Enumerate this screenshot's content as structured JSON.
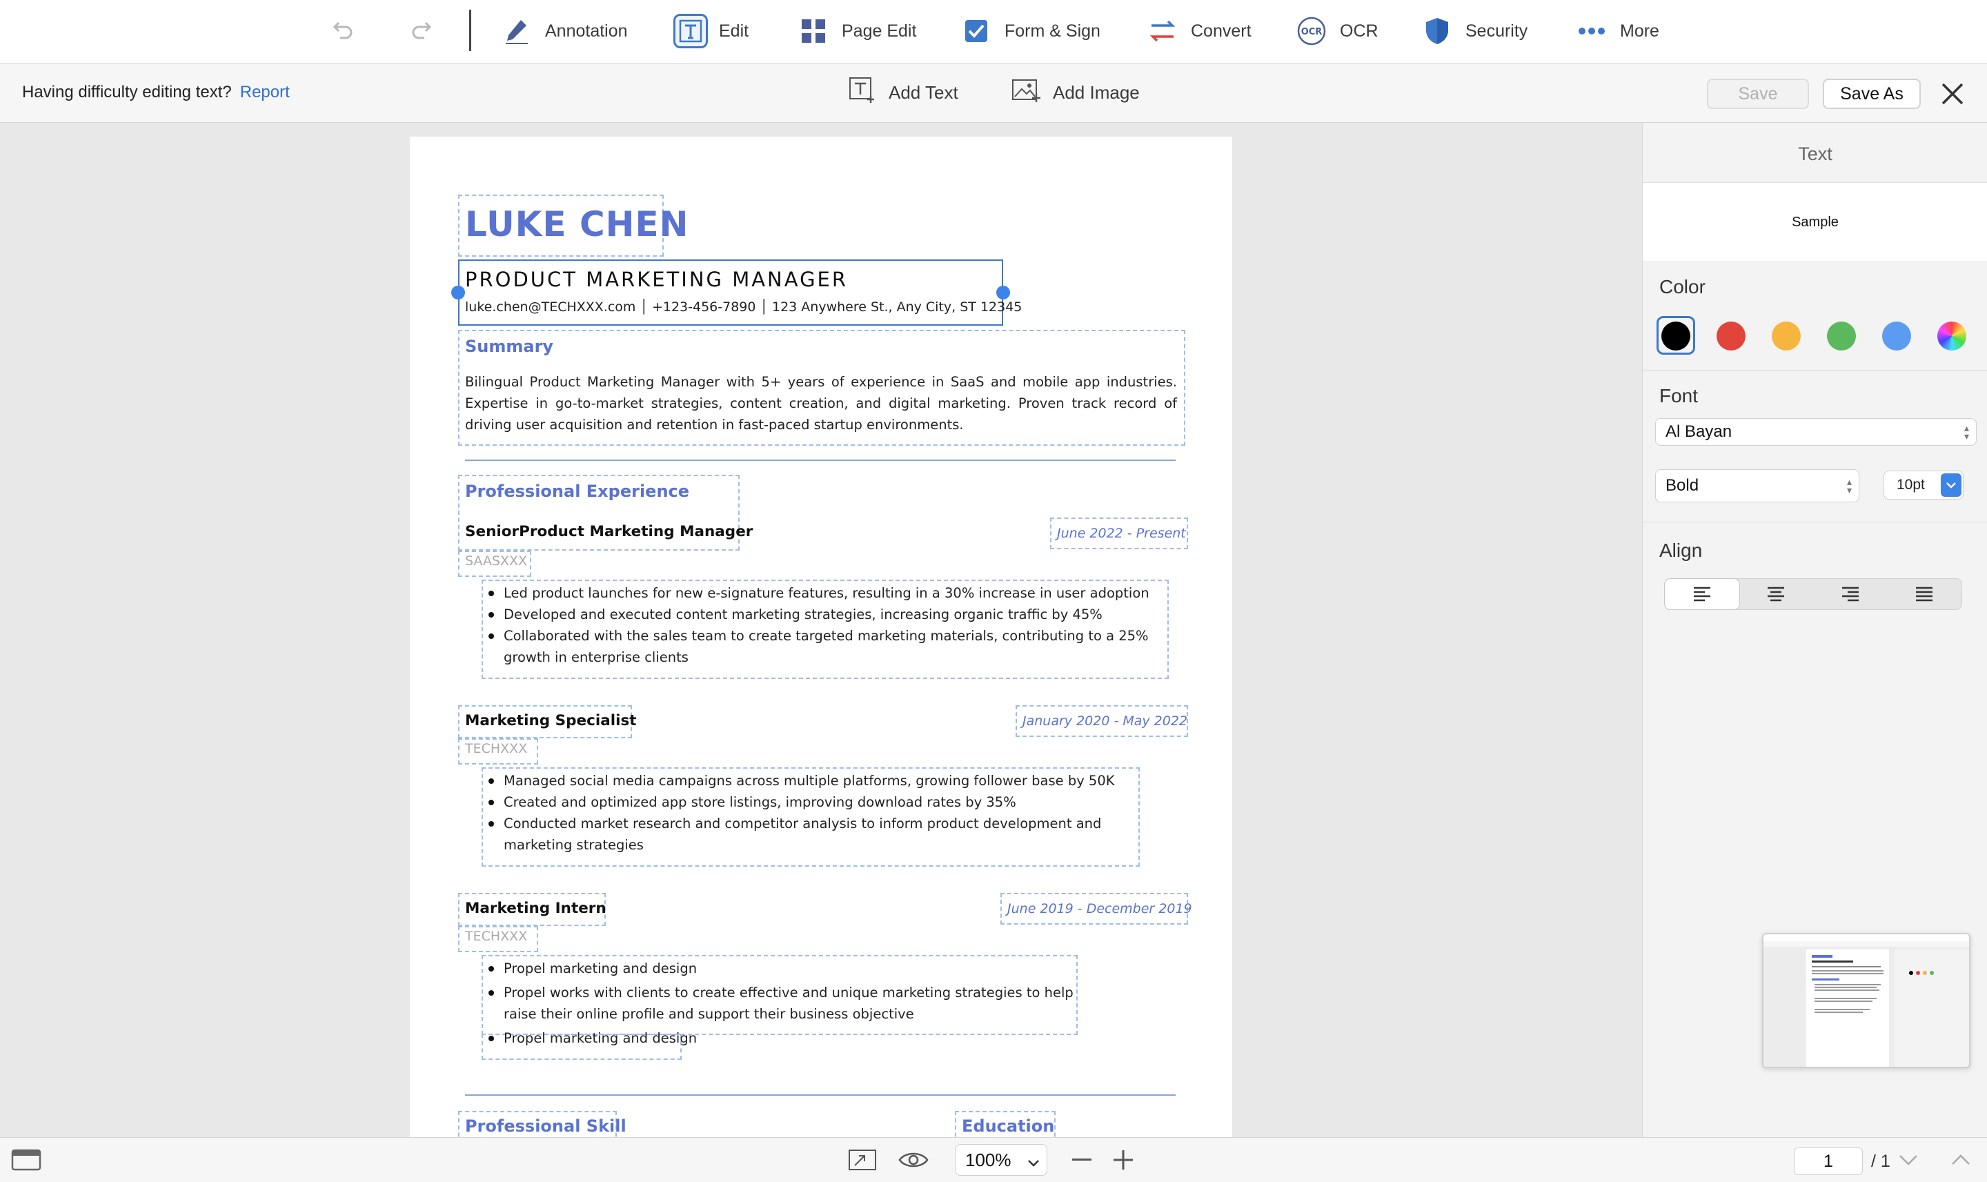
{
  "toolbar": {
    "annotation": "Annotation",
    "edit": "Edit",
    "page_edit": "Page Edit",
    "form_sign": "Form & Sign",
    "convert": "Convert",
    "ocr": "OCR",
    "ocr_glyph": "OCR",
    "security": "Security",
    "more": "More"
  },
  "subbar": {
    "hint": "Having difficulty editing text?",
    "report": "Report",
    "add_text": "Add Text",
    "add_image": "Add Image",
    "save": "Save",
    "save_as": "Save As"
  },
  "resume": {
    "name": "LUKE CHEN",
    "title": "PRODUCT MARKETING MANAGER",
    "contact": "luke.chen@TECHXXX.com │ +123-456-7890 │ 123 Anywhere St., Any City, ST 12345",
    "summary_heading": "Summary",
    "summary": "Bilingual Product Marketing Manager with 5+ years of experience in SaaS and mobile app industries. Expertise in go-to-market strategies, content creation, and digital marketing. Proven track record of driving user acquisition and retention in fast-paced startup environments.",
    "experience_heading": "Professional Experience",
    "jobs": [
      {
        "role": "SeniorProduct Marketing Manager",
        "company": "SAASXXX",
        "date": "June 2022 - Present",
        "bullets": [
          "Led product launches for new e-signature features, resulting in a 30% increase in user adoption",
          "Developed and executed content marketing strategies, increasing organic traffic by 45%",
          "Collaborated with the sales team to create targeted marketing materials, contributing to a 25% growth in enterprise clients"
        ]
      },
      {
        "role": "Marketing Specialist",
        "company": "TECHXXX",
        "date": "January 2020 - May 2022",
        "bullets": [
          "Managed social media campaigns across multiple platforms, growing follower base by 50K",
          "Created and optimized app store listings, improving download rates by 35%",
          "Conducted market research and competitor analysis to inform product development and marketing strategies"
        ]
      },
      {
        "role": "Marketing Intern",
        "company": "TECHXXX",
        "date": "June 2019 - December 2019",
        "bullets": [
          "Propel marketing and design",
          "Propel works with clients to create effective and unique marketing strategies to help raise their online profile and support their business objective",
          "Propel marketing and design"
        ]
      }
    ],
    "skill_heading": "Professional Skill",
    "education_heading": "Education"
  },
  "panel": {
    "title": "Text",
    "sample": "Sample",
    "color_label": "Color",
    "font_label": "Font",
    "font_family": "Al Bayan",
    "font_weight": "Bold",
    "font_size": "10pt",
    "align_label": "Align",
    "colors": [
      "#000000",
      "#e0443a",
      "#f5b53f",
      "#5cb85c",
      "#5b9cf0"
    ]
  },
  "bottombar": {
    "zoom": "100%",
    "page_current": "1",
    "page_total": "/ 1"
  }
}
